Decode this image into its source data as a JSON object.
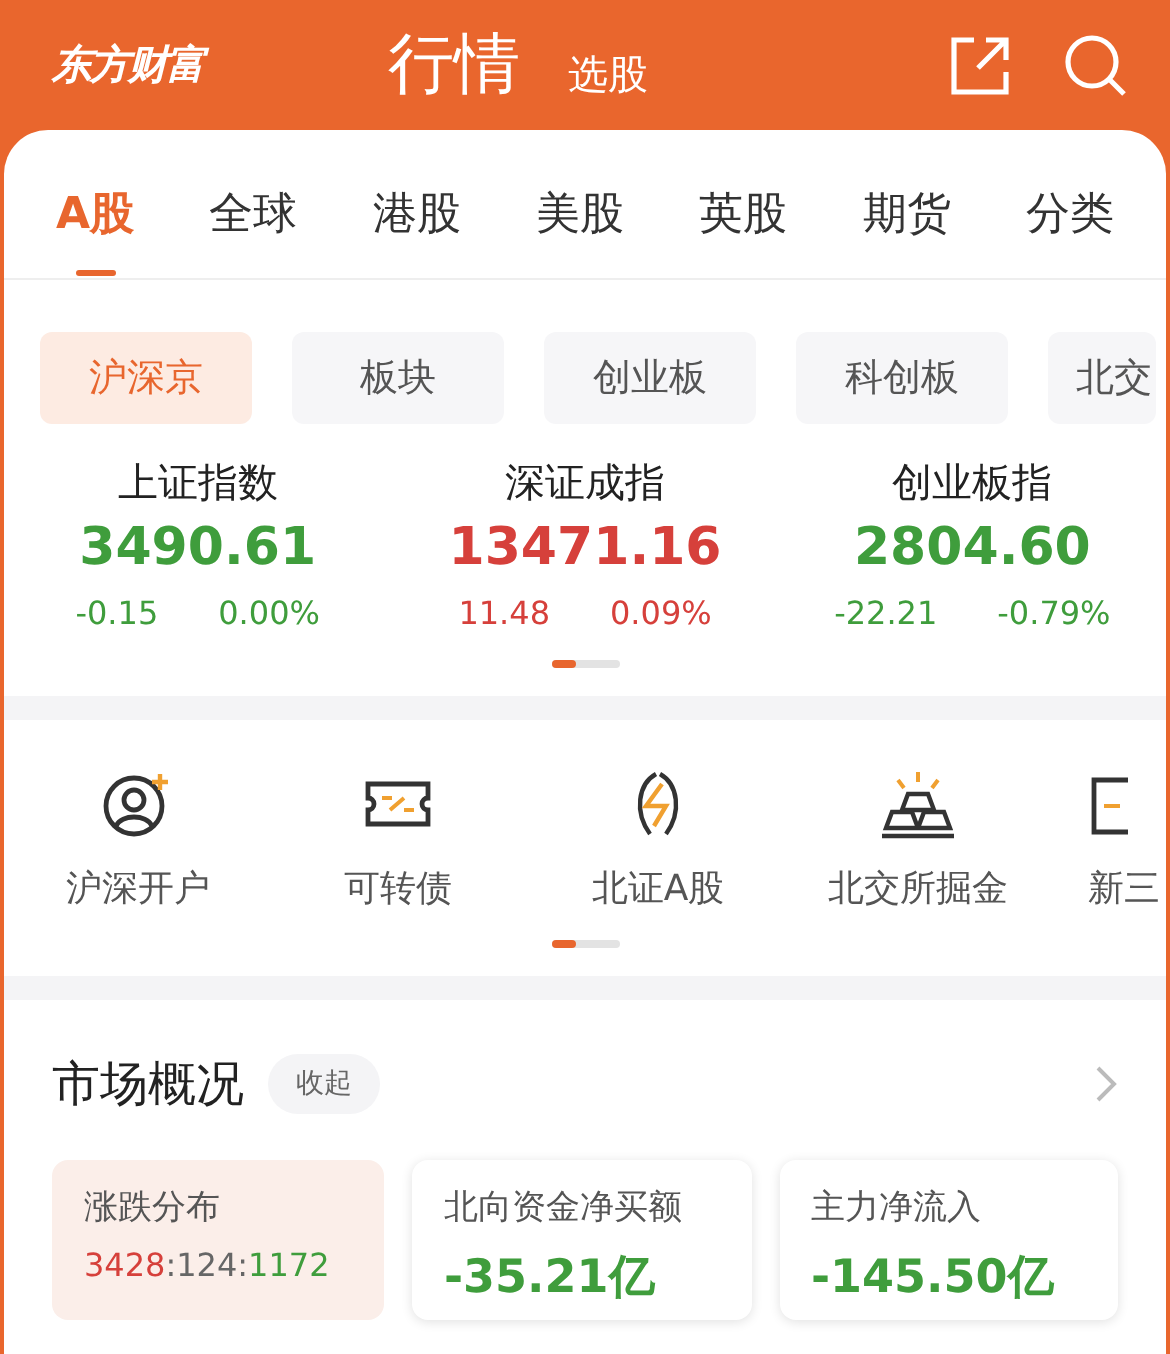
{
  "header": {
    "logo": "东方财富",
    "title": "行情",
    "subtitle": "选股"
  },
  "tabs": [
    {
      "label": "A股",
      "selected": true
    },
    {
      "label": "全球",
      "selected": false
    },
    {
      "label": "港股",
      "selected": false
    },
    {
      "label": "美股",
      "selected": false
    },
    {
      "label": "英股",
      "selected": false
    },
    {
      "label": "期货",
      "selected": false
    },
    {
      "label": "分类",
      "selected": false
    }
  ],
  "chips": [
    {
      "label": "沪深京",
      "selected": true
    },
    {
      "label": "板块",
      "selected": false
    },
    {
      "label": "创业板",
      "selected": false
    },
    {
      "label": "科创板",
      "selected": false
    },
    {
      "label": "北交",
      "selected": false
    }
  ],
  "indices": [
    {
      "name": "上证指数",
      "value": "3490.61",
      "change": "-0.15",
      "percent": "0.00%",
      "kind": "down"
    },
    {
      "name": "深证成指",
      "value": "13471.16",
      "change": "11.48",
      "percent": "0.09%",
      "kind": "up"
    },
    {
      "name": "创业板指",
      "value": "2804.60",
      "change": "-22.21",
      "percent": "-0.79%",
      "kind": "down"
    }
  ],
  "shortcuts": [
    {
      "label": "沪深开户",
      "kind": "account"
    },
    {
      "label": "可转债",
      "kind": "bond"
    },
    {
      "label": "北证A股",
      "kind": "bolt"
    },
    {
      "label": "北交所掘金",
      "kind": "gold"
    },
    {
      "label": "新三",
      "kind": "board"
    }
  ],
  "market": {
    "title": "市场概况",
    "toggle": "收起",
    "cards": [
      {
        "kind": "distribution",
        "title": "涨跌分布",
        "selected": true,
        "up": "3428",
        "flat": "124",
        "down": "1172",
        "sep": ":"
      },
      {
        "kind": "value",
        "title": "北向资金净买额",
        "selected": false,
        "value": "-35.21亿"
      },
      {
        "kind": "value",
        "title": "主力净流入",
        "selected": false,
        "value": "-145.50亿"
      }
    ]
  }
}
